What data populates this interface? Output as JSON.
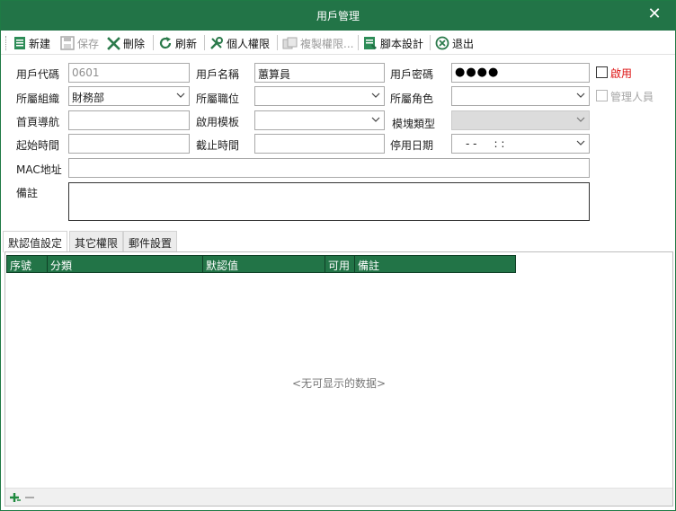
{
  "window": {
    "title": "用戶管理"
  },
  "toolbar": {
    "new": "新建",
    "save": "保存",
    "delete": "刪除",
    "refresh": "刷新",
    "personal_perm": "個人權限",
    "copy_perm": "複製權限...",
    "script_design": "腳本設計",
    "exit": "退出"
  },
  "form": {
    "user_code": {
      "label": "用戶代碼",
      "value": "0601"
    },
    "user_name": {
      "label": "用戶名稱",
      "value": "蕙算員"
    },
    "user_password": {
      "label": "用戶密碼",
      "value": "●●●●"
    },
    "enabled": {
      "label": "啟用"
    },
    "org": {
      "label": "所屬組織",
      "value": "財務部"
    },
    "position": {
      "label": "所屬職位",
      "value": ""
    },
    "role": {
      "label": "所屬角色",
      "value": ""
    },
    "admin": {
      "label": "管理人員"
    },
    "home_nav": {
      "label": "首頁導航",
      "value": ""
    },
    "template": {
      "label": "啟用模板",
      "value": ""
    },
    "module_type": {
      "label": "模塊類型",
      "value": ""
    },
    "start_time": {
      "label": "起始時間",
      "value": ""
    },
    "end_time": {
      "label": "截止時間",
      "value": ""
    },
    "disable_date": {
      "label": "停用日期",
      "value": "- -     : :"
    },
    "mac": {
      "label": "MAC地址",
      "value": ""
    },
    "remark": {
      "label": "備註",
      "value": ""
    }
  },
  "tabs": [
    {
      "label": "默認值設定"
    },
    {
      "label": "其它權限"
    },
    {
      "label": "郵件設置"
    }
  ],
  "grid": {
    "columns": [
      "序號",
      "分類",
      "默認值",
      "可用",
      "備註"
    ],
    "empty_text": "<无可显示的数据>"
  },
  "colors": {
    "accent": "#227447",
    "required": "#dd1111"
  }
}
